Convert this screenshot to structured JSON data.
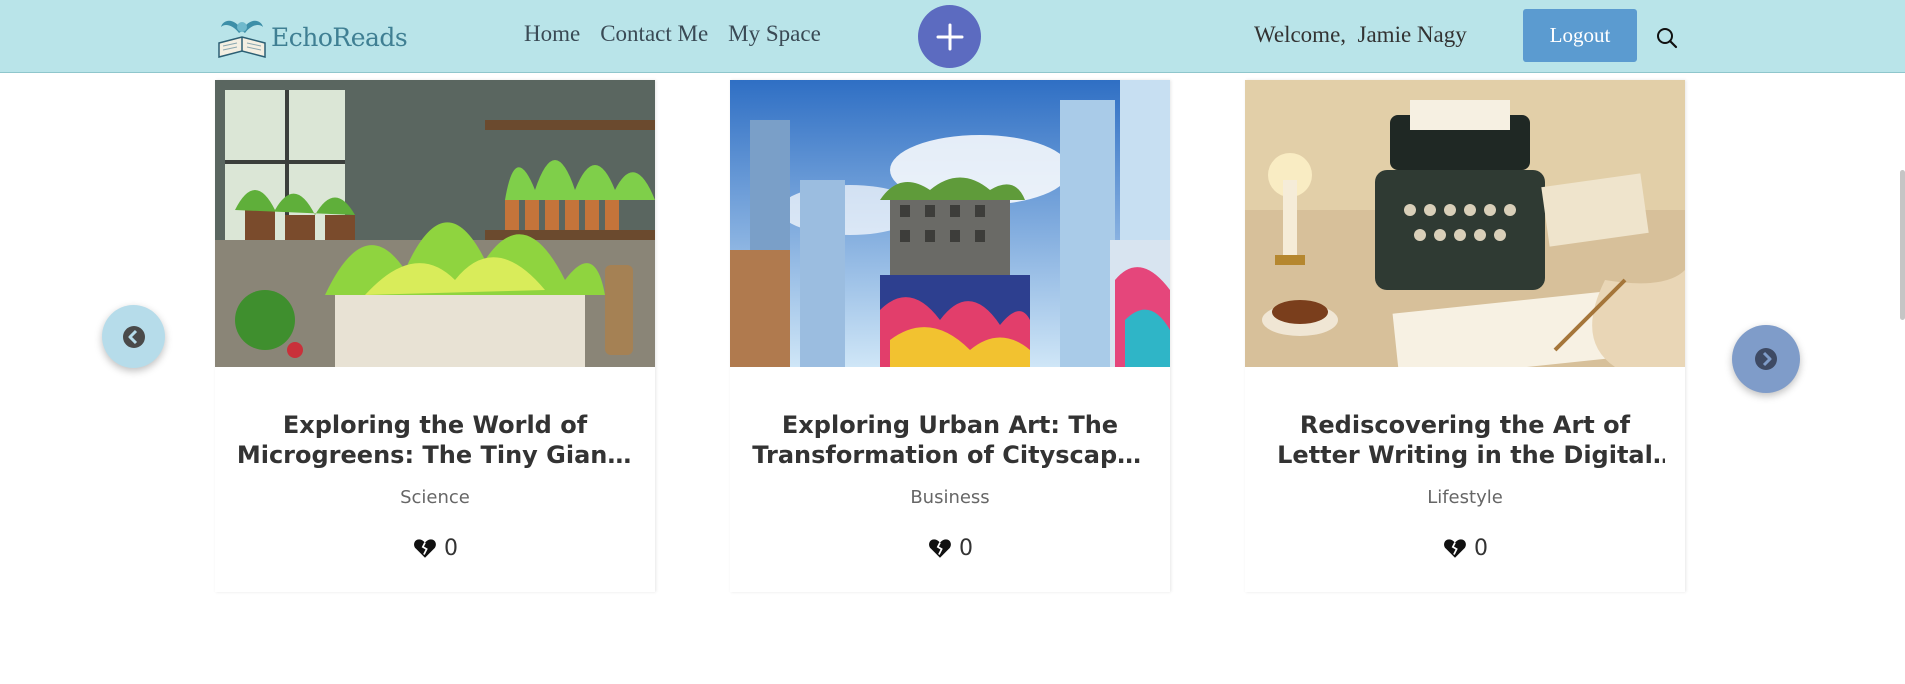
{
  "header": {
    "logo_text": "EchoReads",
    "nav": [
      {
        "label": "Home"
      },
      {
        "label": "Contact Me"
      },
      {
        "label": "My Space"
      }
    ],
    "welcome": "Welcome,  Jamie Nagy",
    "logout_label": "Logout",
    "icons": {
      "add": "plus-icon",
      "search": "search-icon"
    }
  },
  "cards": [
    {
      "title": "Exploring the World of Microgreens: The Tiny Giants of Nutrition",
      "category": "Science",
      "likes": "0",
      "image": "indoor microgreens garden"
    },
    {
      "title": "Exploring Urban Art: The Transformation of Cityscapes Through Murals",
      "category": "Business",
      "likes": "0",
      "image": "city skyscrapers with street art"
    },
    {
      "title": "Rediscovering the Art of Letter Writing in the Digital Age",
      "category": "Lifestyle",
      "likes": "0",
      "image": "vintage typewriter and writing desk"
    }
  ],
  "controls": {
    "prev": "chevron-left-icon",
    "next": "chevron-right-icon"
  },
  "colors": {
    "header_bg": "#b9e4e9",
    "accent": "#5c6bc0",
    "logout_bg": "#5b9bd0"
  }
}
